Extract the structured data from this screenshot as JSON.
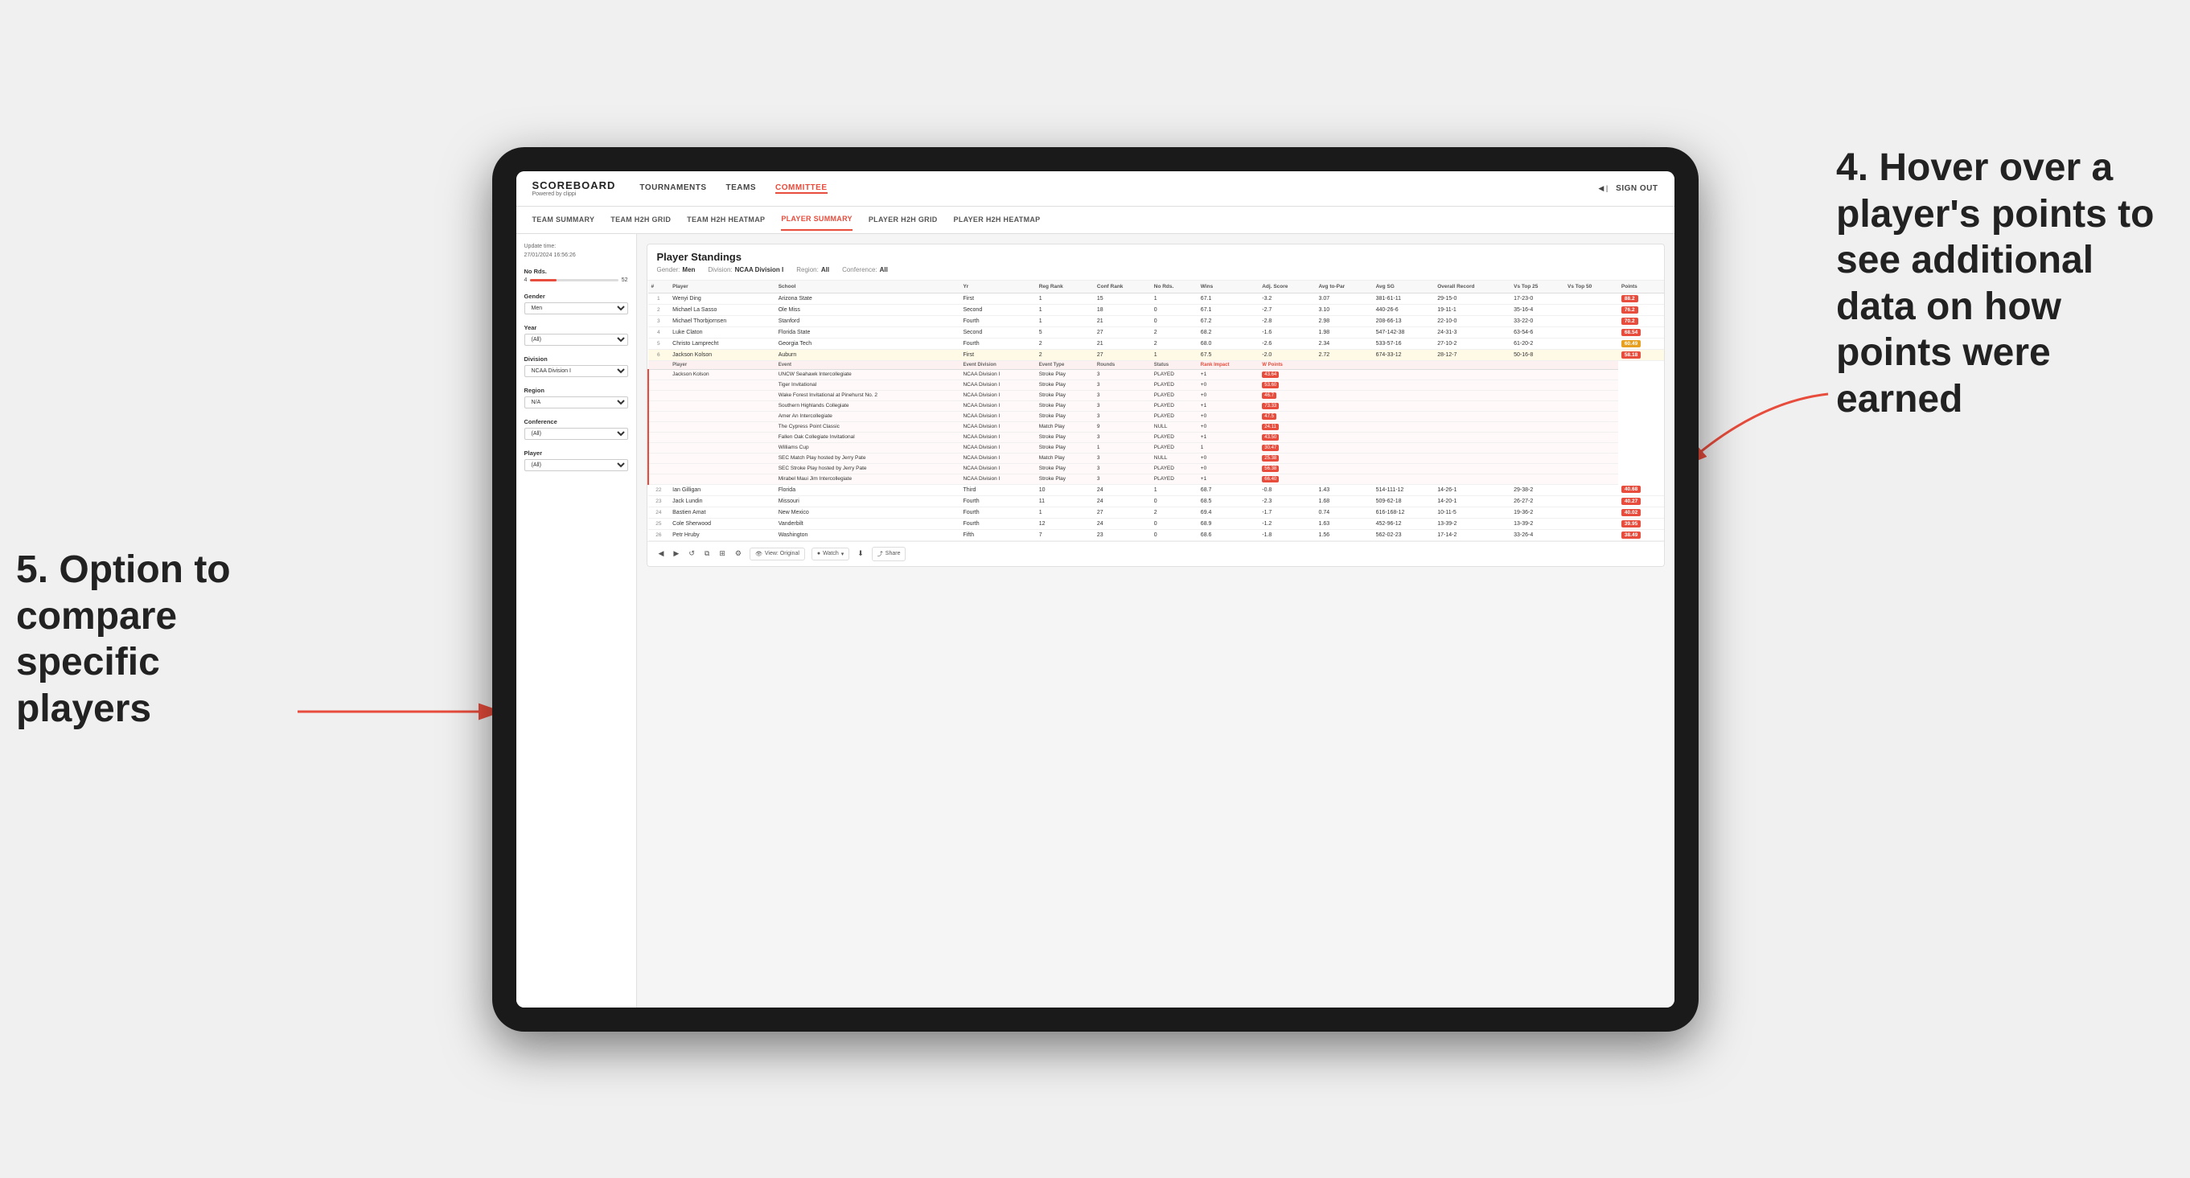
{
  "page": {
    "background": "#f0f0f0"
  },
  "annotations": {
    "right": "4. Hover over a player's points to see additional data on how points were earned",
    "left": "5. Option to compare specific players"
  },
  "nav": {
    "logo": "SCOREBOARD",
    "logo_sub": "Powered by clippi",
    "items": [
      "TOURNAMENTS",
      "TEAMS",
      "COMMITTEE"
    ],
    "active": "COMMITTEE",
    "sign_in": "Sign out"
  },
  "sub_nav": {
    "items": [
      "TEAM SUMMARY",
      "TEAM H2H GRID",
      "TEAM H2H HEATMAP",
      "PLAYER SUMMARY",
      "PLAYER H2H GRID",
      "PLAYER H2H HEATMAP"
    ],
    "active": "PLAYER SUMMARY"
  },
  "sidebar": {
    "update_time_label": "Update time:",
    "update_time_value": "27/01/2024 16:56:26",
    "no_rds_label": "No Rds.",
    "slider_min": "4",
    "slider_max": "52",
    "gender_label": "Gender",
    "gender_value": "Men",
    "year_label": "Year",
    "year_value": "(All)",
    "division_label": "Division",
    "division_value": "NCAA Division I",
    "region_label": "Region",
    "region_value": "N/A",
    "conference_label": "Conference",
    "conference_value": "(All)",
    "player_label": "Player",
    "player_value": "(All)"
  },
  "standings": {
    "title": "Player Standings",
    "gender_label": "Gender:",
    "gender_value": "Men",
    "division_label": "Division:",
    "division_value": "NCAA Division I",
    "region_label": "Region:",
    "region_value": "All",
    "conference_label": "Conference:",
    "conference_value": "All",
    "columns": [
      "#",
      "Player",
      "School",
      "Yr",
      "Reg Rank",
      "Conf Rank",
      "No Rds.",
      "Wins",
      "Adj. Score",
      "Avg to-Par",
      "Avg SG",
      "Overall Record",
      "Vs Top 25",
      "Vs Top 50",
      "Points"
    ],
    "rows": [
      {
        "rank": 1,
        "player": "Wenyi Ding",
        "school": "Arizona State",
        "yr": "First",
        "reg_rank": 1,
        "conf_rank": 15,
        "no_rds": 1,
        "wins": 67.1,
        "adj_score": -3.2,
        "avg_to_par": 3.07,
        "avg_sg": "381-61-11",
        "overall": "29-15-0",
        "vs25": "17-23-0",
        "vs50": "",
        "points": "88.2"
      },
      {
        "rank": 2,
        "player": "Michael La Sasso",
        "school": "Ole Miss",
        "yr": "Second",
        "reg_rank": 1,
        "conf_rank": 18,
        "no_rds": 0,
        "wins": 67.1,
        "adj_score": -2.7,
        "avg_to_par": 3.1,
        "avg_sg": "440-26-6",
        "overall": "19-11-1",
        "vs25": "35-16-4",
        "vs50": "",
        "points": "76.2"
      },
      {
        "rank": 3,
        "player": "Michael Thorbjornsen",
        "school": "Stanford",
        "yr": "Fourth",
        "reg_rank": 1,
        "conf_rank": 21,
        "no_rds": 0,
        "wins": 67.2,
        "adj_score": -2.8,
        "avg_to_par": 2.98,
        "avg_sg": "208-66-13",
        "overall": "22-10-0",
        "vs25": "33-22-0",
        "vs50": "",
        "points": "70.2"
      },
      {
        "rank": 4,
        "player": "Luke Claton",
        "school": "Florida State",
        "yr": "Second",
        "reg_rank": 5,
        "conf_rank": 27,
        "no_rds": 2,
        "wins": 68.2,
        "adj_score": -1.6,
        "avg_to_par": 1.98,
        "avg_sg": "547-142-38",
        "overall": "24-31-3",
        "vs25": "63-54-6",
        "vs50": "",
        "points": "68.54"
      },
      {
        "rank": 5,
        "player": "Christo Lamprecht",
        "school": "Georgia Tech",
        "yr": "Fourth",
        "reg_rank": 2,
        "conf_rank": 21,
        "no_rds": 2,
        "wins": 68.0,
        "adj_score": -2.6,
        "avg_to_par": 2.34,
        "avg_sg": "533-57-16",
        "overall": "27-10-2",
        "vs25": "61-20-2",
        "vs50": "",
        "points": "60.49"
      },
      {
        "rank": 6,
        "player": "Jackson Kolson",
        "school": "Auburn",
        "yr": "First",
        "reg_rank": 2,
        "conf_rank": 27,
        "no_rds": 1,
        "wins": 67.5,
        "adj_score": -2.0,
        "avg_to_par": 2.72,
        "avg_sg": "674-33-12",
        "overall": "28-12-7",
        "vs25": "50-16-8",
        "vs50": "",
        "points": "58.18"
      }
    ],
    "event_header_cols": [
      "Player",
      "Event",
      "Event Division",
      "Event Type",
      "Rounds",
      "Status",
      "Rank Impact",
      "W Points"
    ],
    "event_rows": [
      {
        "player": "Jackson Kolson",
        "event": "UNCW Seahawk Intercollegiate",
        "division": "NCAA Division I",
        "type": "Stroke Play",
        "rounds": 3,
        "status": "PLAYED",
        "rank_impact": "+1",
        "w_points": "43.64"
      },
      {
        "player": "",
        "event": "Tiger Invitational",
        "division": "NCAA Division I",
        "type": "Stroke Play",
        "rounds": 3,
        "status": "PLAYED",
        "rank_impact": "+0",
        "w_points": "53.60"
      },
      {
        "player": "",
        "event": "Wake Forest Invitational at Pinehurst No. 2",
        "division": "NCAA Division I",
        "type": "Stroke Play",
        "rounds": 3,
        "status": "PLAYED",
        "rank_impact": "+0",
        "w_points": "46.7"
      },
      {
        "player": "",
        "event": "Southern Highlands Collegiate",
        "division": "NCAA Division I",
        "type": "Stroke Play",
        "rounds": 3,
        "status": "PLAYED",
        "rank_impact": "+1",
        "w_points": "73.33"
      },
      {
        "player": "",
        "event": "Amer An Intercollegiate",
        "division": "NCAA Division I",
        "type": "Stroke Play",
        "rounds": 3,
        "status": "PLAYED",
        "rank_impact": "+0",
        "w_points": "47.5"
      },
      {
        "player": "",
        "event": "The Cypress Point Classic",
        "division": "NCAA Division I",
        "type": "Match Play",
        "rounds": 9,
        "status": "NULL",
        "rank_impact": "+0",
        "w_points": "24.11"
      },
      {
        "player": "",
        "event": "Fallen Oak Collegiate Invitational",
        "division": "NCAA Division I",
        "type": "Stroke Play",
        "rounds": 3,
        "status": "PLAYED",
        "rank_impact": "+1",
        "w_points": "43.50"
      },
      {
        "player": "",
        "event": "Williams Cup",
        "division": "NCAA Division I",
        "type": "Stroke Play",
        "rounds": 1,
        "status": "PLAYED",
        "rank_impact": "1",
        "w_points": "30.47"
      },
      {
        "player": "",
        "event": "SEC Match Play hosted by Jerry Pate",
        "division": "NCAA Division I",
        "type": "Match Play",
        "rounds": 3,
        "status": "NULL",
        "rank_impact": "+0",
        "w_points": "25.38"
      },
      {
        "player": "",
        "event": "SEC Stroke Play hosted by Jerry Pate",
        "division": "NCAA Division I",
        "type": "Stroke Play",
        "rounds": 3,
        "status": "PLAYED",
        "rank_impact": "+0",
        "w_points": "56.38"
      },
      {
        "player": "",
        "event": "Mirabel Maui Jim Intercollegiate",
        "division": "NCAA Division I",
        "type": "Stroke Play",
        "rounds": 3,
        "status": "PLAYED",
        "rank_impact": "+1",
        "w_points": "66.40"
      }
    ],
    "lower_rows": [
      {
        "rank": 22,
        "player": "Ian Gilligan",
        "school": "Florida",
        "yr": "Third",
        "reg_rank": 10,
        "conf_rank": 24,
        "no_rds": 1,
        "wins": 68.7,
        "adj_score": -0.8,
        "avg_to_par": 1.43,
        "avg_sg": "514-111-12",
        "overall": "14-26-1",
        "vs25": "29-38-2",
        "vs50": "",
        "points": "40.68"
      },
      {
        "rank": 23,
        "player": "Jack Lundin",
        "school": "Missouri",
        "yr": "Fourth",
        "reg_rank": 11,
        "conf_rank": 24,
        "no_rds": 0,
        "wins": 68.5,
        "adj_score": -2.3,
        "avg_to_par": 1.68,
        "avg_sg": "509-62-18",
        "overall": "14-20-1",
        "vs25": "26-27-2",
        "vs50": "",
        "points": "40.27"
      },
      {
        "rank": 24,
        "player": "Bastien Amat",
        "school": "New Mexico",
        "yr": "Fourth",
        "reg_rank": 1,
        "conf_rank": 27,
        "no_rds": 2,
        "wins": 69.4,
        "adj_score": -1.7,
        "avg_to_par": 0.74,
        "avg_sg": "616-168-12",
        "overall": "10-11-5",
        "vs25": "19-36-2",
        "vs50": "",
        "points": "40.02"
      },
      {
        "rank": 25,
        "player": "Cole Sherwood",
        "school": "Vanderbilt",
        "yr": "Fourth",
        "reg_rank": 12,
        "conf_rank": 24,
        "no_rds": 0,
        "wins": 68.9,
        "adj_score": -1.2,
        "avg_to_par": 1.63,
        "avg_sg": "452-96-12",
        "overall": "13-39-2",
        "vs25": "13-39-2",
        "vs50": "",
        "points": "39.95"
      },
      {
        "rank": 26,
        "player": "Petr Hruby",
        "school": "Washington",
        "yr": "Fifth",
        "reg_rank": 7,
        "conf_rank": 23,
        "no_rds": 0,
        "wins": 68.6,
        "adj_score": -1.8,
        "avg_to_par": 1.56,
        "avg_sg": "562-02-23",
        "overall": "17-14-2",
        "vs25": "33-26-4",
        "vs50": "",
        "points": "38.49"
      }
    ]
  },
  "toolbar": {
    "view_label": "View: Original",
    "watch_label": "Watch",
    "share_label": "Share"
  }
}
